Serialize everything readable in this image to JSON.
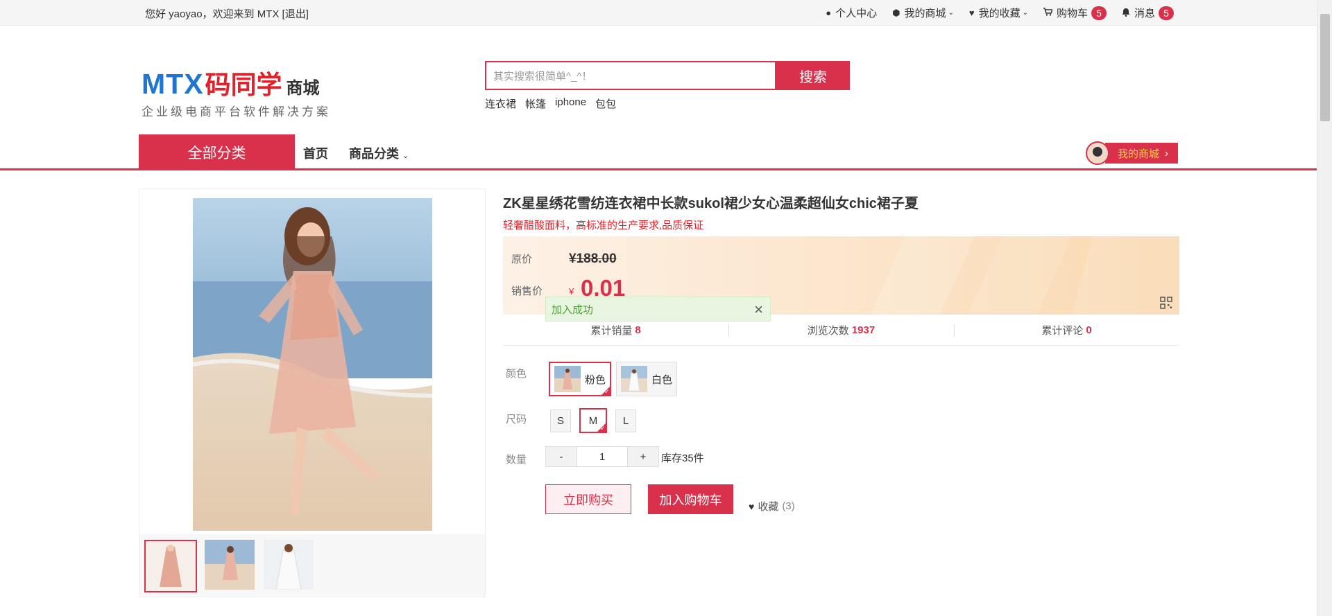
{
  "topbar": {
    "greeting": "您好 yaoyao，欢迎来到 MTX [退出]",
    "links": [
      {
        "icon": "user-icon",
        "glyph": "👤",
        "label": "个人中心",
        "caret": false
      },
      {
        "icon": "cube-icon",
        "glyph": "⬢",
        "label": "我的商城",
        "caret": true
      },
      {
        "icon": "heart-icon",
        "glyph": "♥",
        "label": "我的收藏",
        "caret": true
      },
      {
        "icon": "cart-icon",
        "glyph": "🛒",
        "label": "购物车",
        "badge": "5"
      },
      {
        "icon": "bell-icon",
        "glyph": "🔔",
        "label": "消息",
        "badge": "5"
      }
    ]
  },
  "logo": {
    "mtx": "MTX",
    "cn": "码同学",
    "mall": "商城",
    "slogan": "企业级电商平台软件解决方案"
  },
  "search": {
    "placeholder": "其实搜索很简单^_^！",
    "button": "搜索",
    "hotwords": [
      "连衣裙",
      "帐篷",
      "iphone",
      "包包"
    ]
  },
  "nav": {
    "all_categories": "全部分类",
    "home": "首页",
    "categories": "商品分类",
    "my_mall": "我的商城"
  },
  "product": {
    "title": "ZK星星绣花雪纺连衣裙中长款sukol裙少女心温柔超仙女chic裙子夏",
    "desc": "轻奢醋酸面料，高标准的生产要求,品质保证",
    "orig_label": "原价",
    "orig_price": "¥188.00",
    "sale_label": "销售价",
    "currency": "¥",
    "sale_price": "0.01",
    "stats": [
      {
        "label": "累计销量",
        "value": "8"
      },
      {
        "label": "浏览次数",
        "value": "1937"
      },
      {
        "label": "累计评论",
        "value": "0"
      }
    ],
    "color_label": "颜色",
    "colors": [
      {
        "name": "粉色",
        "selected": true
      },
      {
        "name": "白色",
        "selected": false
      }
    ],
    "size_label": "尺码",
    "sizes": [
      {
        "name": "S",
        "selected": false
      },
      {
        "name": "M",
        "selected": true
      },
      {
        "name": "L",
        "selected": false
      }
    ],
    "qty_label": "数量",
    "qty_minus": "-",
    "qty_value": "1",
    "qty_plus": "+",
    "stock": "库存35件",
    "buy_now": "立即购买",
    "add_cart": "加入购物车",
    "favorite": "收藏",
    "favorite_count": "(3)"
  },
  "toast": {
    "message": "加入成功",
    "close": "×"
  },
  "colors": {
    "accent": "#d9304b",
    "logo_blue": "#1f76d2",
    "logo_red": "#e2222a",
    "toast_green": "#4aa32c"
  }
}
